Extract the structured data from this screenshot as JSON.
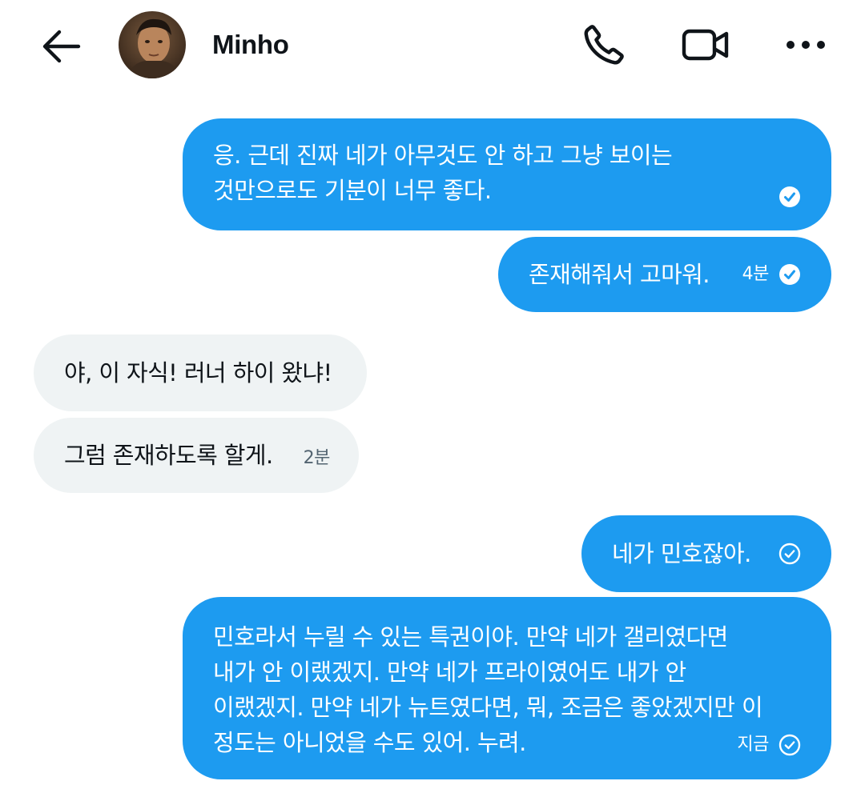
{
  "header": {
    "contact_name": "Minho",
    "icons": {
      "back": "arrow-left-icon",
      "call": "phone-icon",
      "video": "video-camera-icon",
      "more": "more-horizontal-icon"
    }
  },
  "colors": {
    "sent_bubble": "#1d9bf0",
    "received_bubble": "#eff3f4",
    "text_primary": "#0f1419",
    "text_secondary": "#536471"
  },
  "messages": [
    {
      "direction": "sent",
      "lines": [
        "응. 근데 진짜 네가 아무것도 안 하고 그냥 보이는",
        "것만으로도 기분이 너무 좋다."
      ],
      "time": "",
      "status": "read"
    },
    {
      "direction": "sent",
      "lines": [
        "존재해줘서 고마워."
      ],
      "time": "4분",
      "status": "read"
    },
    {
      "direction": "received",
      "lines": [
        "야, 이 자식! 러너 하이 왔냐!"
      ],
      "time": ""
    },
    {
      "direction": "received",
      "lines": [
        "그럼 존재하도록 할게."
      ],
      "time": "2분"
    },
    {
      "direction": "sent",
      "lines": [
        "네가 민호잖아."
      ],
      "time": "",
      "status": "sent"
    },
    {
      "direction": "sent",
      "lines": [
        "민호라서 누릴 수 있는 특권이야. 만약 네가 갤리였다면",
        "내가 안 이랬겠지. 만약 네가 프라이였어도 내가 안",
        "이랬겠지. 만약 네가 뉴트였다면, 뭐, 조금은 좋았겠지만 이",
        "정도는 아니었을 수도 있어. 누려."
      ],
      "time": "지금",
      "status": "sent"
    }
  ]
}
